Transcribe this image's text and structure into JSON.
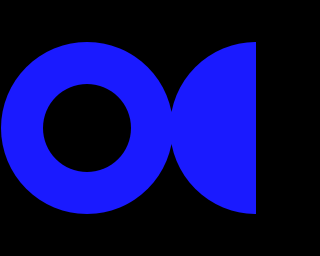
{
  "colors": {
    "background": "#000000",
    "ring": "#1a1aff",
    "half_disc": "#1a1aff",
    "ring_hole": "#000000"
  },
  "shapes": {
    "left": "ring-icon",
    "right": "half-disc-icon"
  }
}
